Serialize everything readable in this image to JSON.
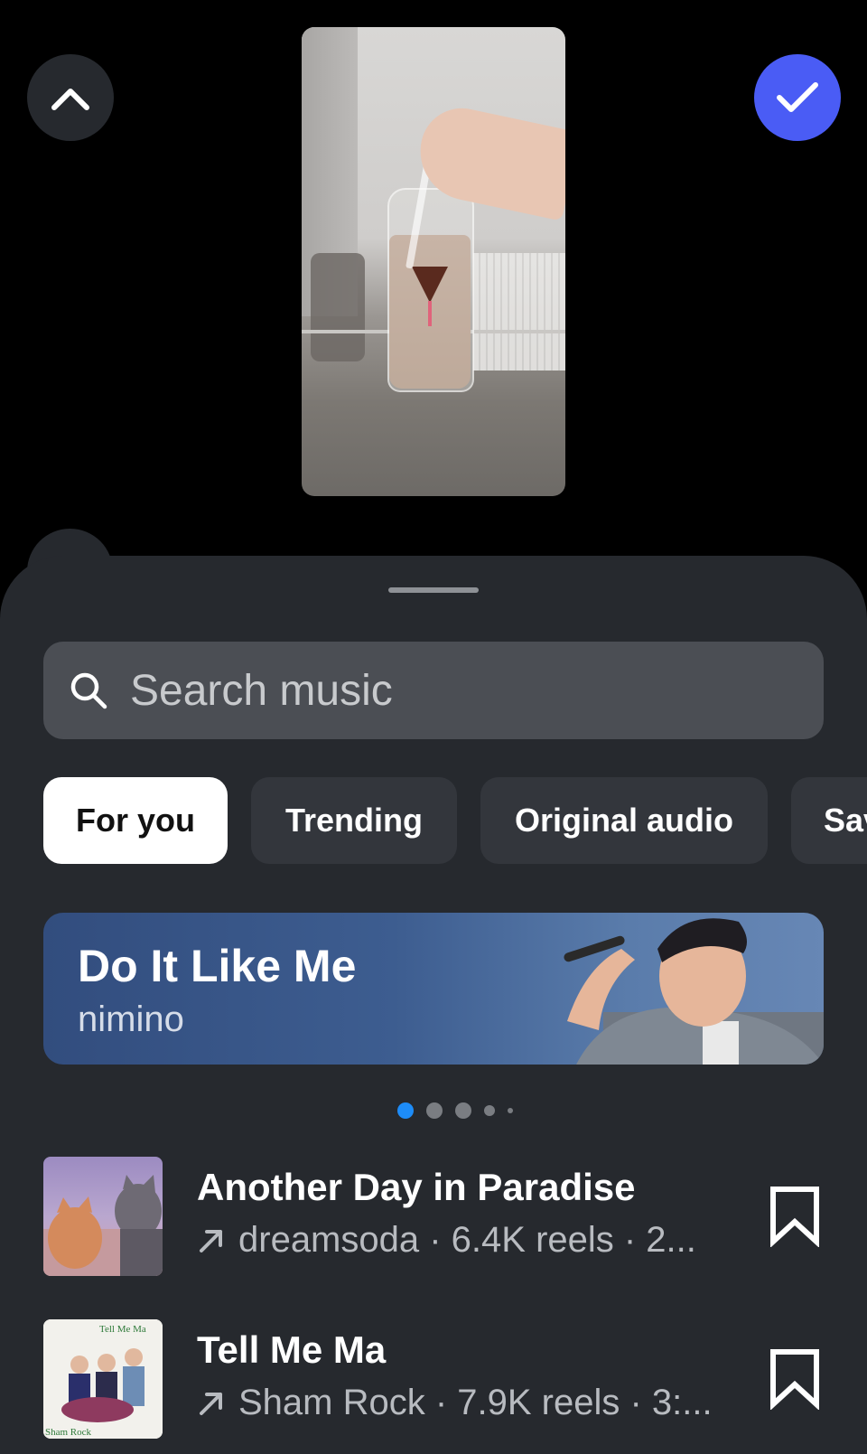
{
  "header": {
    "collapse_icon": "chevron-up-icon",
    "confirm_icon": "checkmark-icon",
    "confirm_color": "#4a5cf5"
  },
  "search": {
    "placeholder": "Search music",
    "icon": "search-icon"
  },
  "tabs": [
    {
      "label": "For you",
      "active": true
    },
    {
      "label": "Trending",
      "active": false
    },
    {
      "label": "Original audio",
      "active": false
    },
    {
      "label": "Sav",
      "active": false
    }
  ],
  "featured": {
    "title": "Do It Like Me",
    "artist": "nimino"
  },
  "carousel": {
    "active_index": 0,
    "active_color": "#1d8cf8"
  },
  "tracks": [
    {
      "title": "Another Day in Paradise",
      "meta": "dreamsoda · 6.4K reels · 2...",
      "trend_icon": "trending-arrow-icon",
      "save_icon": "bookmark-icon"
    },
    {
      "title": "Tell Me Ma",
      "meta": "Sham Rock · 7.9K reels · 3:...",
      "trend_icon": "trending-arrow-icon",
      "save_icon": "bookmark-icon",
      "art_text_top": "Tell Me Ma",
      "art_text_bottom": "Sham Rock"
    }
  ]
}
